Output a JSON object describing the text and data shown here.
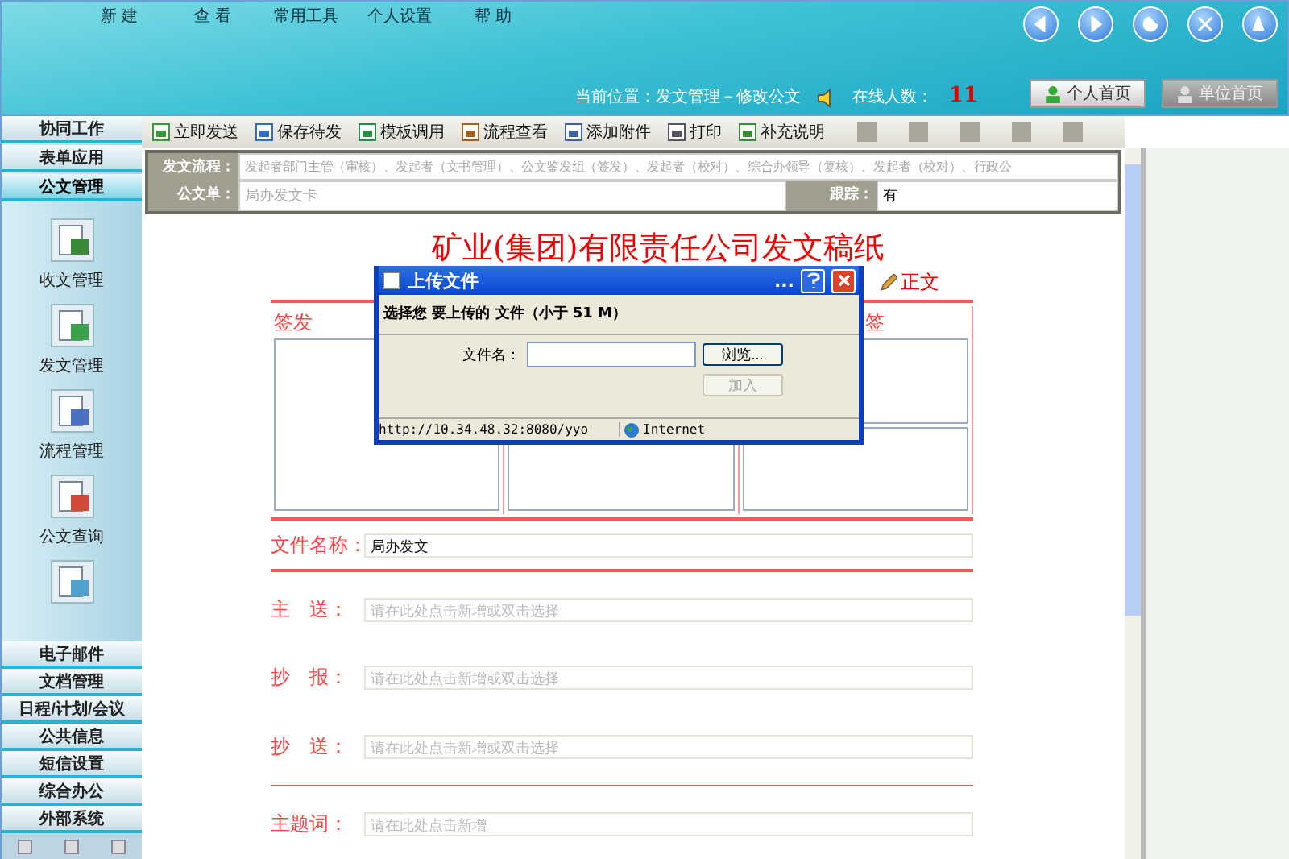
{
  "menu": [
    {
      "label": "新 建"
    },
    {
      "label": "查 看"
    },
    {
      "label": "常用工具"
    },
    {
      "label": "个人设置"
    },
    {
      "label": "帮 助"
    }
  ],
  "header": {
    "location_label": "当前位置：",
    "location": "发文管理－修改公文",
    "online_label": "在线人数：",
    "online_count": "11",
    "buttons": [
      {
        "label": "个人首页",
        "selected": false
      },
      {
        "label": "单位首页",
        "selected": true
      }
    ]
  },
  "sidebar": {
    "top_groups": [
      {
        "label": "协同工作",
        "selected": false
      },
      {
        "label": "表单应用",
        "selected": false
      },
      {
        "label": "公文管理",
        "selected": true
      }
    ],
    "modules": [
      {
        "label": "收文管理",
        "kind": "inbox"
      },
      {
        "label": "发文管理",
        "kind": "outbox"
      },
      {
        "label": "流程管理",
        "kind": "flow"
      },
      {
        "label": "公文查询",
        "kind": "query"
      },
      {
        "kind": "supervise"
      }
    ],
    "bottom_groups": [
      {
        "label": "电子邮件"
      },
      {
        "label": "文档管理"
      },
      {
        "label": "日程/计划/会议"
      },
      {
        "label": "公共信息"
      },
      {
        "label": "短信设置"
      },
      {
        "label": "综合办公"
      },
      {
        "label": "外部系统"
      }
    ]
  },
  "toolbar": [
    {
      "label": "立即发送",
      "kind": "send"
    },
    {
      "label": "保存待发",
      "kind": "save"
    },
    {
      "label": "模板调用",
      "kind": "template"
    },
    {
      "label": "流程查看",
      "kind": "flow"
    },
    {
      "label": "添加附件",
      "kind": "attach"
    },
    {
      "label": "打印",
      "kind": "print"
    },
    {
      "label": "补充说明",
      "kind": "note"
    },
    {
      "kind": "blank"
    },
    {
      "kind": "blank"
    },
    {
      "kind": "blank"
    },
    {
      "kind": "blank"
    },
    {
      "kind": "blank"
    }
  ],
  "form": {
    "flow_label": "发文流程：",
    "flow": "发起者部门主管（审核）、发起者（文书管理）、公文鉴发组（签发）、发起者（校对）、综合办领导（复核）、发起者（校对）、行政公",
    "doc_label": "公文单：",
    "doc": "局办发文卡",
    "track_label": "跟踪：",
    "track": "有"
  },
  "document": {
    "title": "矿业(集团)有限责任公司发文稿纸",
    "body_link": "正文",
    "sign_label": "签发",
    "check_label": "签",
    "fields": [
      {
        "label": "文件名称：",
        "value": "局办发文"
      },
      {
        "label": "主　送：",
        "placeholder": "请在此处点击新增或双击选择"
      },
      {
        "label": "抄　报：",
        "placeholder": "请在此处点击新增或双击选择"
      },
      {
        "label": "抄　送：",
        "placeholder": "请在此处点击新增或双击选择"
      },
      {
        "label": "主题词：",
        "placeholder": "请在此处点击新增"
      }
    ]
  },
  "dialog": {
    "title": "上传文件",
    "title_extra": "...",
    "prompt": "选择您 要上传的 文件（小于 51 M）",
    "file_label": "文件名：",
    "browse": "浏览...",
    "add": "加入",
    "add_disabled": true,
    "status_url": "http://10.34.48.32:8080/yyo",
    "status_zone": "Internet"
  }
}
